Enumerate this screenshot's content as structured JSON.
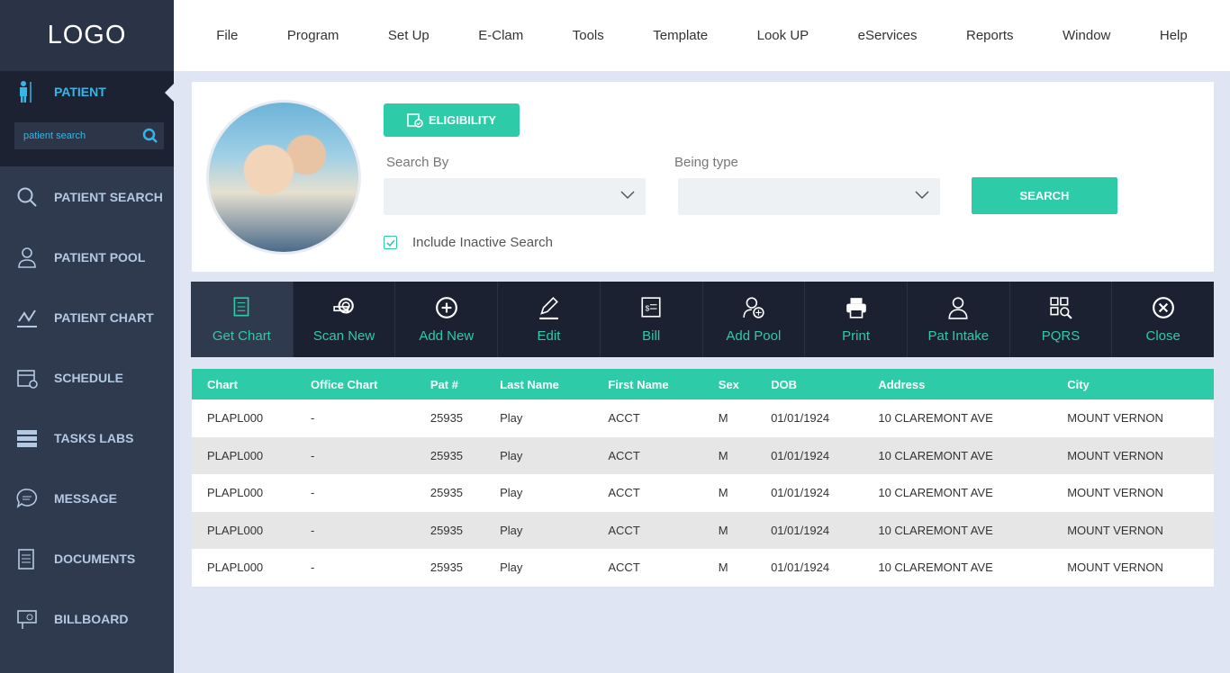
{
  "logo": "LOGO",
  "sidebar": {
    "patient_label": "PATIENT",
    "search_placeholder": "patient search",
    "items": [
      {
        "label": "PATIENT SEARCH",
        "icon": "search-icon"
      },
      {
        "label": "PATIENT POOL",
        "icon": "user-icon"
      },
      {
        "label": "PATIENT CHART",
        "icon": "chart-icon"
      },
      {
        "label": "SCHEDULE",
        "icon": "calendar-icon"
      },
      {
        "label": "TASKS LABS",
        "icon": "server-icon"
      },
      {
        "label": "MESSAGE",
        "icon": "chat-icon"
      },
      {
        "label": "DOCUMENTS",
        "icon": "document-icon"
      },
      {
        "label": "BILLBOARD",
        "icon": "billboard-icon"
      }
    ]
  },
  "menu": [
    "File",
    "Program",
    "Set Up",
    "E-Clam",
    "Tools",
    "Template",
    "Look UP",
    "eServices",
    "Reports",
    "Window",
    "Help"
  ],
  "search": {
    "eligibility": "ELIGIBILITY",
    "search_by": "Search By",
    "being_type": "Being type",
    "search_button": "SEARCH",
    "include_inactive": "Include Inactive Search"
  },
  "toolbar": [
    "Get Chart",
    "Scan New",
    "Add New",
    "Edit",
    "Bill",
    "Add Pool",
    "Print",
    "Pat Intake",
    "PQRS",
    "Close"
  ],
  "table": {
    "headers": [
      "Chart",
      "Office Chart",
      "Pat #",
      "Last Name",
      "First Name",
      "Sex",
      "DOB",
      "Address",
      "City"
    ],
    "rows": [
      [
        "PLAPL000",
        "-",
        "25935",
        "Play",
        "ACCT",
        "M",
        "01/01/1924",
        "10 CLAREMONT AVE",
        "MOUNT VERNON"
      ],
      [
        "PLAPL000",
        "-",
        "25935",
        "Play",
        "ACCT",
        "M",
        "01/01/1924",
        "10 CLAREMONT AVE",
        "MOUNT VERNON"
      ],
      [
        "PLAPL000",
        "-",
        "25935",
        "Play",
        "ACCT",
        "M",
        "01/01/1924",
        "10 CLAREMONT AVE",
        "MOUNT VERNON"
      ],
      [
        "PLAPL000",
        "-",
        "25935",
        "Play",
        "ACCT",
        "M",
        "01/01/1924",
        "10 CLAREMONT AVE",
        "MOUNT VERNON"
      ],
      [
        "PLAPL000",
        "-",
        "25935",
        "Play",
        "ACCT",
        "M",
        "01/01/1924",
        "10 CLAREMONT AVE",
        "MOUNT VERNON"
      ]
    ]
  },
  "colors": {
    "accent": "#2ecba8",
    "sidebar": "#2f3a4e",
    "dark": "#1b2130"
  }
}
